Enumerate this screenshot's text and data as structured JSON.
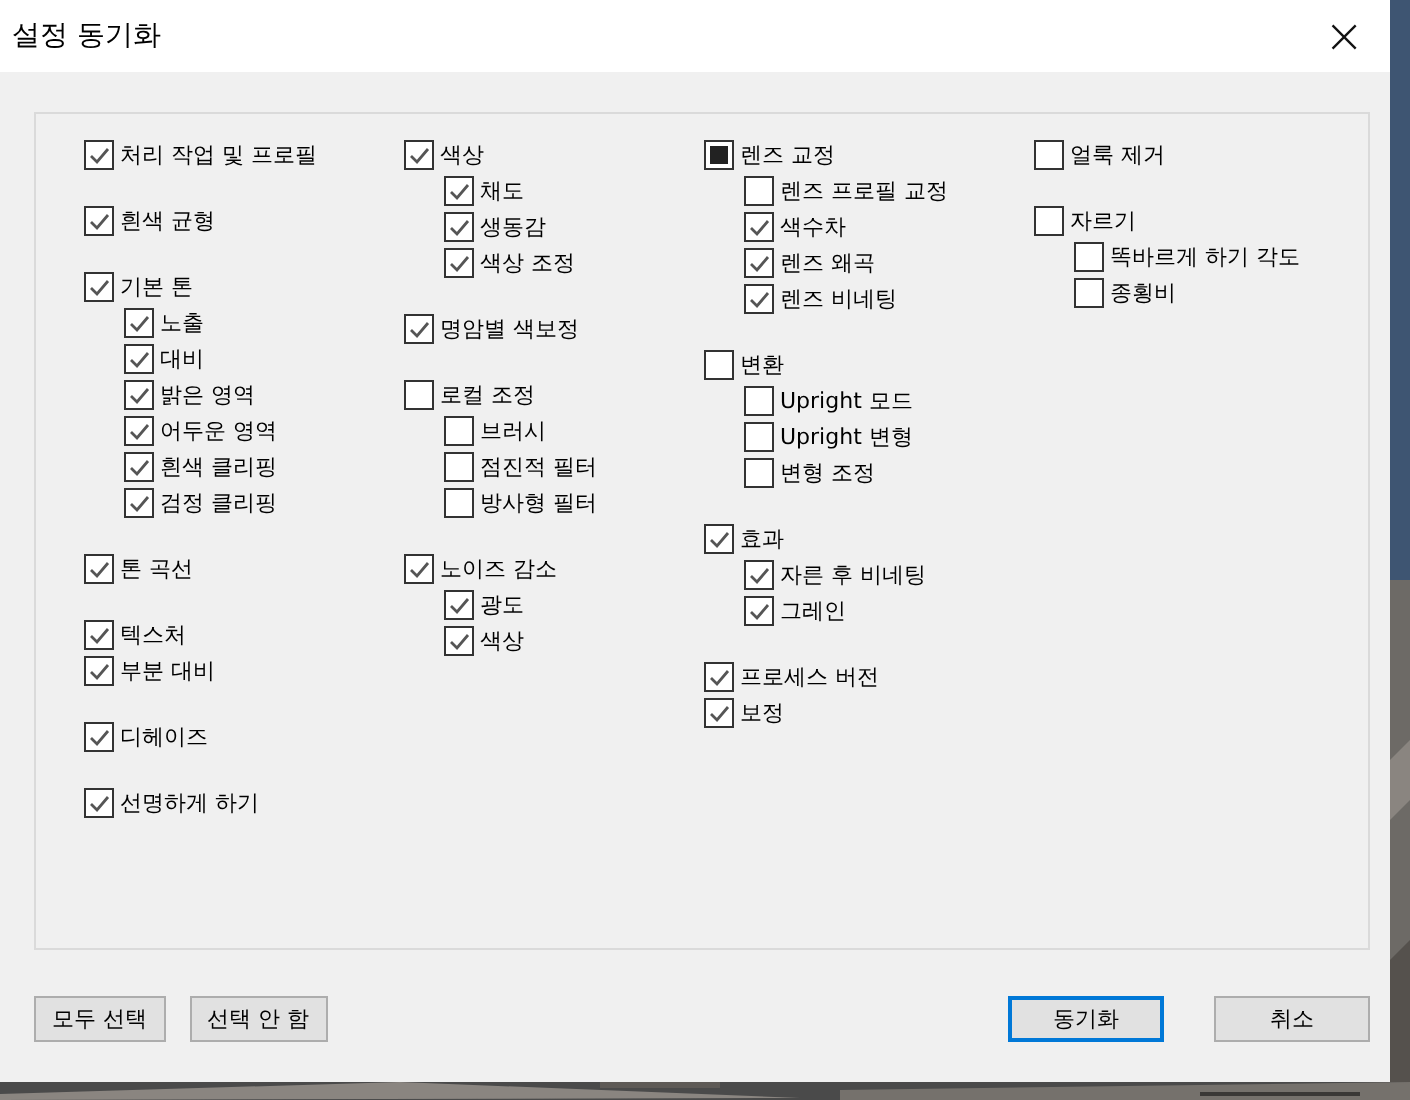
{
  "window": {
    "title": "설정 동기화",
    "close": "×"
  },
  "columns": [
    {
      "groups": [
        {
          "items": [
            {
              "label": "처리 작업 및 프로필",
              "checked": true,
              "partial": false
            }
          ]
        },
        {
          "items": [
            {
              "label": "흰색 균형",
              "checked": true,
              "partial": false
            }
          ]
        },
        {
          "items": [
            {
              "label": "기본 톤",
              "checked": true,
              "partial": false,
              "children": [
                {
                  "label": "노출",
                  "checked": true
                },
                {
                  "label": "대비",
                  "checked": true
                },
                {
                  "label": "밝은 영역",
                  "checked": true
                },
                {
                  "label": "어두운 영역",
                  "checked": true
                },
                {
                  "label": "흰색 클리핑",
                  "checked": true
                },
                {
                  "label": "검정 클리핑",
                  "checked": true
                }
              ]
            }
          ]
        },
        {
          "items": [
            {
              "label": "톤 곡선",
              "checked": true,
              "partial": false
            }
          ]
        },
        {
          "items": [
            {
              "label": "텍스처",
              "checked": true,
              "partial": false
            },
            {
              "label": "부분 대비",
              "checked": true,
              "partial": false
            }
          ]
        },
        {
          "items": [
            {
              "label": "디헤이즈",
              "checked": true,
              "partial": false
            }
          ]
        },
        {
          "items": [
            {
              "label": "선명하게 하기",
              "checked": true,
              "partial": false
            }
          ]
        }
      ]
    },
    {
      "groups": [
        {
          "items": [
            {
              "label": "색상",
              "checked": true,
              "partial": false,
              "children": [
                {
                  "label": "채도",
                  "checked": true
                },
                {
                  "label": "생동감",
                  "checked": true
                },
                {
                  "label": "색상 조정",
                  "checked": true
                }
              ]
            }
          ]
        },
        {
          "items": [
            {
              "label": "명암별 색보정",
              "checked": true,
              "partial": false
            }
          ]
        },
        {
          "items": [
            {
              "label": "로컬 조정",
              "checked": false,
              "partial": false,
              "children": [
                {
                  "label": "브러시",
                  "checked": false
                },
                {
                  "label": "점진적 필터",
                  "checked": false
                },
                {
                  "label": "방사형 필터",
                  "checked": false
                }
              ]
            }
          ]
        },
        {
          "items": [
            {
              "label": "노이즈 감소",
              "checked": true,
              "partial": false,
              "children": [
                {
                  "label": "광도",
                  "checked": true
                },
                {
                  "label": "색상",
                  "checked": true
                }
              ]
            }
          ]
        }
      ]
    },
    {
      "groups": [
        {
          "items": [
            {
              "label": "렌즈 교정",
              "checked": false,
              "partial": true,
              "children": [
                {
                  "label": "렌즈 프로필 교정",
                  "checked": false
                },
                {
                  "label": "색수차",
                  "checked": true
                },
                {
                  "label": "렌즈 왜곡",
                  "checked": true
                },
                {
                  "label": "렌즈 비네팅",
                  "checked": true
                }
              ]
            }
          ]
        },
        {
          "items": [
            {
              "label": "변환",
              "checked": false,
              "partial": false,
              "children": [
                {
                  "label": "Upright 모드",
                  "checked": false
                },
                {
                  "label": "Upright 변형",
                  "checked": false
                },
                {
                  "label": "변형 조정",
                  "checked": false
                }
              ]
            }
          ]
        },
        {
          "items": [
            {
              "label": "효과",
              "checked": true,
              "partial": false,
              "children": [
                {
                  "label": "자른 후 비네팅",
                  "checked": true
                },
                {
                  "label": "그레인",
                  "checked": true
                }
              ]
            }
          ]
        },
        {
          "items": [
            {
              "label": "프로세스 버전",
              "checked": true,
              "partial": false
            },
            {
              "label": "보정",
              "checked": true,
              "partial": false
            }
          ]
        }
      ]
    },
    {
      "groups": [
        {
          "items": [
            {
              "label": "얼룩 제거",
              "checked": false,
              "partial": false
            }
          ]
        },
        {
          "items": [
            {
              "label": "자르기",
              "checked": false,
              "partial": false,
              "children": [
                {
                  "label": "똑바르게 하기 각도",
                  "checked": false
                },
                {
                  "label": "종횡비",
                  "checked": false
                }
              ]
            }
          ]
        }
      ]
    }
  ],
  "buttons_left": [
    {
      "label": "모두 선택",
      "default": false
    },
    {
      "label": "선택 안 함",
      "default": false
    }
  ],
  "buttons_right": [
    {
      "label": "동기화",
      "default": true
    },
    {
      "label": "취소",
      "default": false
    }
  ]
}
